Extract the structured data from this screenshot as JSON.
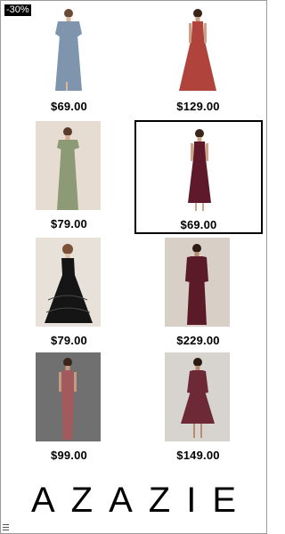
{
  "badge": {
    "text": "-30%"
  },
  "products": [
    {
      "price": "$69.00",
      "dress_color": "#7f95ad",
      "bg": "#ffffff"
    },
    {
      "price": "$129.00",
      "dress_color": "#b0433b",
      "bg": "#ffffff"
    },
    {
      "price": "$79.00",
      "dress_color": "#8c9a76",
      "bg": "#e6dcd2"
    },
    {
      "price": "$69.00",
      "dress_color": "#5e1a2b",
      "bg": "#ffffff"
    },
    {
      "price": "$79.00",
      "dress_color": "#151515",
      "bg": "#e8e1da"
    },
    {
      "price": "$229.00",
      "dress_color": "#5a1a28",
      "bg": "#d8cfc6"
    },
    {
      "price": "$99.00",
      "dress_color": "#a35a5c",
      "bg": "#707070"
    },
    {
      "price": "$149.00",
      "dress_color": "#6d2a36",
      "bg": "#d7d3cf"
    }
  ],
  "brand": {
    "logo": "AZAZIE"
  },
  "menu_icon": "hamburger-menu-icon"
}
